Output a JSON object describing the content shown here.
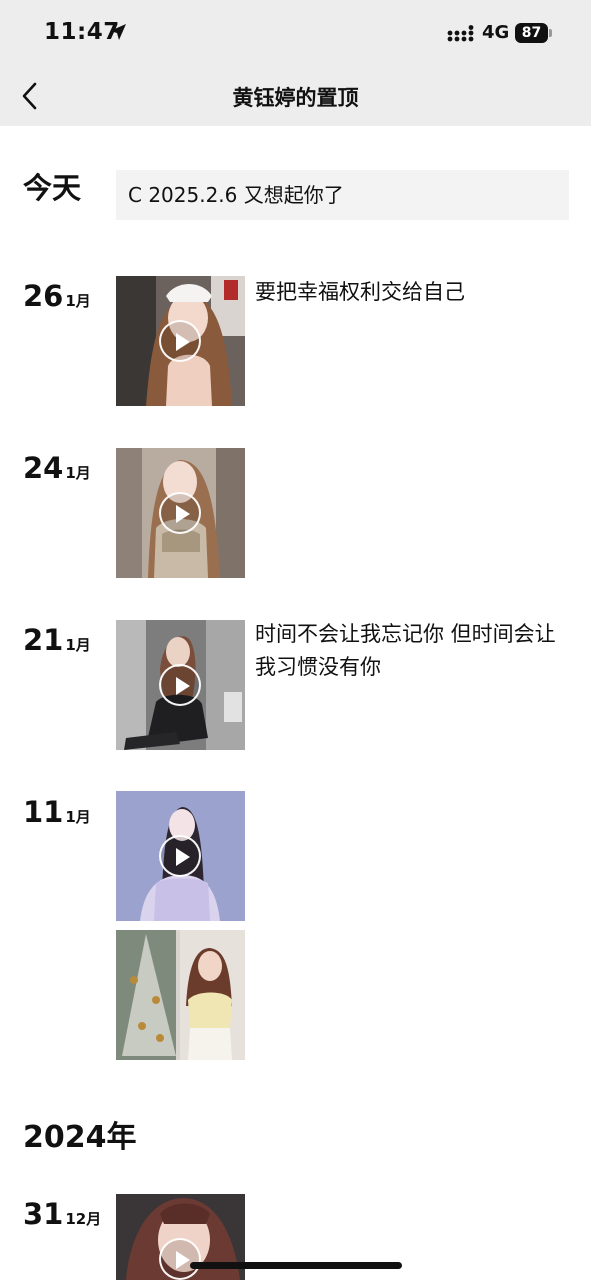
{
  "status_bar": {
    "time": "11:47",
    "network": "4G",
    "battery": "87"
  },
  "nav": {
    "title": "黄钰婷的置顶"
  },
  "posts": [
    {
      "day": "今天",
      "month": "",
      "text": "C 2025.2.6 又想起你了"
    },
    {
      "day": "26",
      "month": "1月",
      "caption": "要把幸福权利交给自己",
      "video": true
    },
    {
      "day": "24",
      "month": "1月",
      "caption": "",
      "video": true
    },
    {
      "day": "21",
      "month": "1月",
      "caption": "时间不会让我忘记你 但时间会让我习惯没有你",
      "video": true
    },
    {
      "day": "11",
      "month": "1月",
      "caption": "",
      "video": true,
      "extra_image": true
    }
  ],
  "year_header": "2024年",
  "posts_2024": [
    {
      "day": "31",
      "month": "12月",
      "video": true
    }
  ]
}
